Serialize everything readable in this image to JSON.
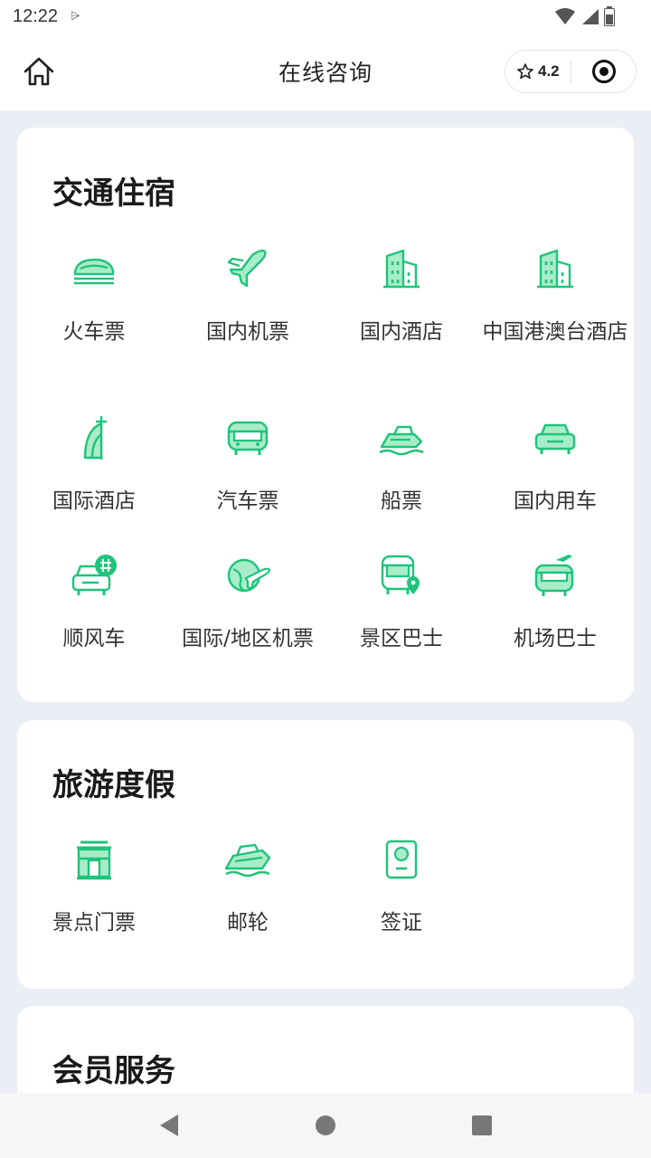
{
  "status": {
    "time": "12:22",
    "extra": "⩥"
  },
  "header": {
    "title": "在线咨询",
    "rating": "4.2"
  },
  "sections": [
    {
      "title": "交通住宿",
      "items": [
        {
          "label": "火车票",
          "icon": "train-icon"
        },
        {
          "label": "国内机票",
          "icon": "airplane-icon"
        },
        {
          "label": "国内酒店",
          "icon": "hotel-building-icon"
        },
        {
          "label": "中国港澳台酒店",
          "icon": "hotel-building-icon"
        },
        {
          "label": "国际酒店",
          "icon": "sail-hotel-icon"
        },
        {
          "label": "汽车票",
          "icon": "bus-icon"
        },
        {
          "label": "船票",
          "icon": "ship-icon"
        },
        {
          "label": "国内用车",
          "icon": "car-icon"
        },
        {
          "label": "顺风车",
          "icon": "carpool-icon"
        },
        {
          "label": "国际/地区机票",
          "icon": "globe-plane-icon"
        },
        {
          "label": "景区巴士",
          "icon": "location-bus-icon"
        },
        {
          "label": "机场巴士",
          "icon": "airport-bus-icon"
        }
      ]
    },
    {
      "title": "旅游度假",
      "items": [
        {
          "label": "景点门票",
          "icon": "gate-icon"
        },
        {
          "label": "邮轮",
          "icon": "cruise-icon"
        },
        {
          "label": "签证",
          "icon": "visa-icon"
        }
      ]
    },
    {
      "title": "会员服务",
      "items": []
    }
  ],
  "colors": {
    "accent": "#1ec47a",
    "accent_light": "#a9ecc9",
    "background": "#eceef5"
  }
}
